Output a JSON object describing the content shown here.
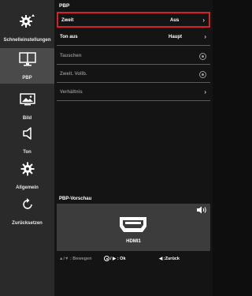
{
  "sidebar": {
    "items": [
      {
        "label": "Schnelleinstellungen",
        "icon": "quick-settings-gear-icon",
        "active": false
      },
      {
        "label": "PBP",
        "icon": "pbp-monitor-icon",
        "active": true
      },
      {
        "label": "Bild",
        "icon": "picture-icon",
        "active": false
      },
      {
        "label": "Ton",
        "icon": "speaker-icon",
        "active": false
      },
      {
        "label": "Allgemein",
        "icon": "gear-icon",
        "active": false
      },
      {
        "label": "Zurücksetzen",
        "icon": "reset-icon",
        "active": false
      }
    ]
  },
  "main": {
    "title": "PBP",
    "rows": [
      {
        "label": "Zweit",
        "value": "Aus",
        "control": "chevron",
        "selected": true,
        "dim": false
      },
      {
        "label": "Ton aus",
        "value": "Haupt",
        "control": "chevron",
        "selected": false,
        "dim": false
      },
      {
        "label": "Tauschen",
        "value": "",
        "control": "radio",
        "selected": false,
        "dim": true
      },
      {
        "label": "Zweit. Vollb.",
        "value": "",
        "control": "radio",
        "selected": false,
        "dim": true
      },
      {
        "label": "Verhältnis",
        "value": "",
        "control": "chevron",
        "selected": false,
        "dim": true
      }
    ],
    "chevron_glyph": "›"
  },
  "preview": {
    "title": "PBP-Vorschau",
    "input": "HDMI1"
  },
  "footer": {
    "navigate": "▲/▼ : Bewegen",
    "ok_suffix": "/ ▶ : Ok",
    "back": "◀ :Zurück"
  },
  "colors": {
    "selection_border": "#d9202a",
    "sidebar_bg": "#2a2a2a",
    "sidebar_active_bg": "#4a4a4a",
    "panel_bg": "#141414",
    "preview_bg": "#3c3c3c"
  }
}
